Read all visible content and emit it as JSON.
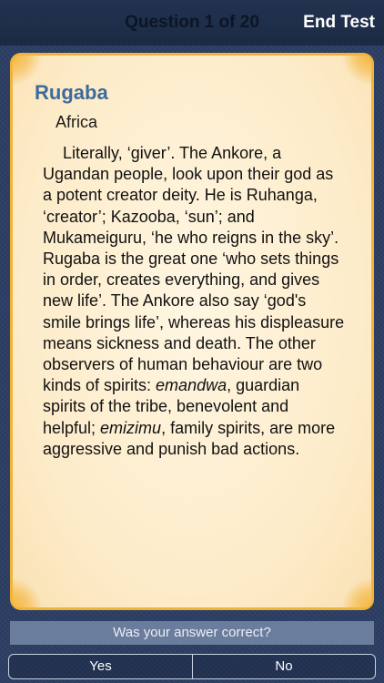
{
  "header": {
    "title": "Question 1 of 20",
    "end_test_label": "End Test"
  },
  "card": {
    "name": "Rugaba",
    "region": "Africa",
    "description": {
      "part1": "Literally, ‘giver’. The Ankore, a Ugandan people, look upon their god as a potent creator deity. He is Ruhanga, ‘creator’; Kazooba, ‘sun’; and Mukameiguru, ‘he who reigns in the sky’. Rugaba is the great one ‘who sets things in order, creates everything, and gives new life’. The Ankore also say ‘god's smile brings life’, whereas his displeasure means sickness and death. The other observers of human behaviour are two kinds of spirits: ",
      "italic1": "emandwa",
      "part2": ", guardian spirits of the tribe, benevolent and helpful; ",
      "italic2": "emizimu",
      "part3": ", family spirits, are more aggressive and punish bad actions."
    }
  },
  "prompt": {
    "question": "Was your answer correct?",
    "yes_label": "Yes",
    "no_label": "No"
  },
  "colors": {
    "background": "#2c3e63",
    "card_border": "#f1b43a",
    "card_fill": "#fdebc8",
    "name_color": "#3c6b9c",
    "question_bar": "#6b7d9c"
  }
}
